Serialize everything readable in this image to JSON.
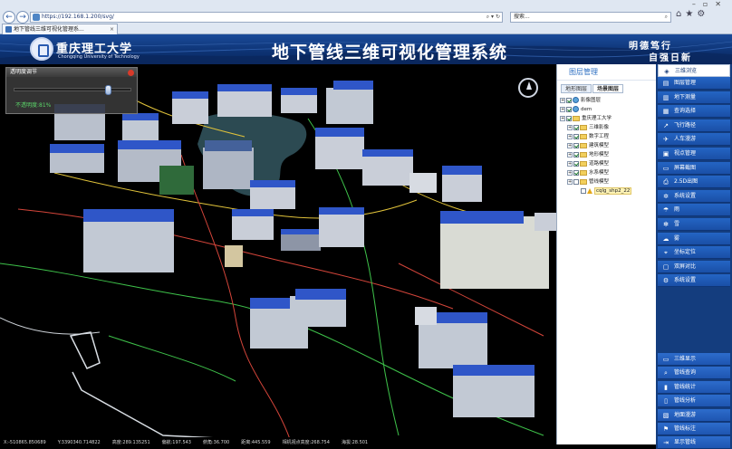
{
  "browser": {
    "url": "https://192.168.1.200/svg/",
    "search_placeholder": "搜索...",
    "tab_title": "地下管线三维可视化管理系..."
  },
  "header": {
    "school_name": "重庆理工大学",
    "school_en": "Chongqing University of Technology",
    "title": "地下管线三维可视化管理系统",
    "motto_line1": "明德笃行",
    "motto_line2": "自强日新"
  },
  "transparency": {
    "title": "透明度调节",
    "value_text": "不透明度:81%",
    "opacity": 0.81
  },
  "layer_panel": {
    "title": "图层管理",
    "tabs": [
      "地形图层",
      "场景图层"
    ],
    "active_tab": 1,
    "tree": [
      {
        "label": "影像图层",
        "level": 0,
        "checked": true,
        "icon": "globe-icon"
      },
      {
        "label": "dem",
        "level": 0,
        "checked": true,
        "icon": "globe-icon"
      },
      {
        "label": "重庆理工大学",
        "level": 0,
        "checked": true,
        "icon": "folder-icon"
      },
      {
        "label": "三维影像",
        "level": 1,
        "checked": true,
        "icon": "folder-icon"
      },
      {
        "label": "数字工程",
        "level": 1,
        "checked": true,
        "icon": "folder-icon"
      },
      {
        "label": "建筑模型",
        "level": 1,
        "checked": true,
        "icon": "folder-icon"
      },
      {
        "label": "地形模型",
        "level": 1,
        "checked": true,
        "icon": "folder-icon"
      },
      {
        "label": "道路模型",
        "level": 1,
        "checked": true,
        "icon": "folder-icon"
      },
      {
        "label": "水系模型",
        "level": 1,
        "checked": true,
        "icon": "folder-icon"
      },
      {
        "label": "管线模型",
        "level": 1,
        "checked": false,
        "icon": "folder-icon"
      },
      {
        "label": "cqlg_shp2_22",
        "level": 2,
        "checked": false,
        "icon": "warning-icon",
        "highlight": true
      }
    ]
  },
  "menu": {
    "top": {
      "label": "三维浏览",
      "icon": "cube-icon"
    },
    "items": [
      {
        "label": "图层管理",
        "icon": "layers-icon"
      },
      {
        "label": "地下测量",
        "icon": "building-icon"
      },
      {
        "label": "查询选择",
        "icon": "select-icon"
      },
      {
        "label": "飞行路径",
        "icon": "flight-path-icon"
      },
      {
        "label": "人车漫游",
        "icon": "walk-icon"
      },
      {
        "label": "视点管理",
        "icon": "viewpoint-icon"
      },
      {
        "label": "屏幕截图",
        "icon": "camera-icon"
      },
      {
        "label": "2.5D出图",
        "icon": "print-icon"
      },
      {
        "label": "系统设置",
        "icon": "settings-icon"
      },
      {
        "label": "雨",
        "icon": "rain-icon"
      },
      {
        "label": "雪",
        "icon": "snow-icon"
      },
      {
        "label": "雾",
        "icon": "fog-icon"
      },
      {
        "label": "坐标定位",
        "icon": "locate-icon"
      },
      {
        "label": "双屏对比",
        "icon": "compare-icon"
      },
      {
        "label": "系统设置",
        "icon": "gear-icon"
      }
    ],
    "tools": [
      {
        "label": "三维显示",
        "icon": "monitor-icon"
      },
      {
        "label": "管线查询",
        "icon": "search-icon"
      },
      {
        "label": "管线统计",
        "icon": "stats-icon"
      },
      {
        "label": "管线分析",
        "icon": "chart-icon"
      },
      {
        "label": "地面漫游",
        "icon": "roam-icon"
      },
      {
        "label": "管线标注",
        "icon": "flag-icon"
      },
      {
        "label": "显示管线",
        "icon": "exit-icon"
      }
    ]
  },
  "status_bar": [
    "X:-510865.850689",
    "Y:3390340.714822",
    "高度:289.135251",
    "偏航:197.543",
    "俯角:36.700",
    "距离:445.559",
    "相机视点高度:268.754",
    "海拔:28.501"
  ],
  "colors": {
    "header_bg": "#0d3272",
    "menu_bg": "#1a4fa6",
    "roof_blue": "#2f56c8",
    "pipe_green": "#3ec24a",
    "pipe_red": "#d4453a",
    "pipe_yellow": "#e0c23a"
  }
}
